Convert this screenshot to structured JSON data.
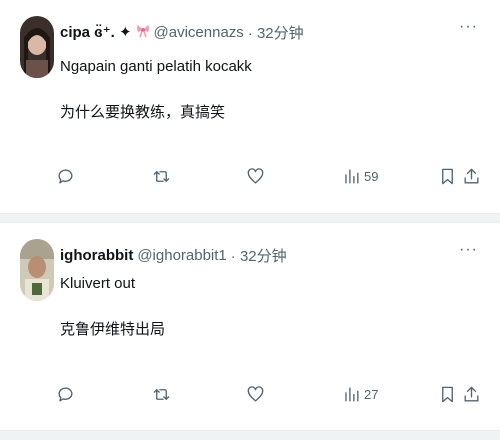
{
  "tweets": [
    {
      "name": "cipa ɞ̈⁺. ✦",
      "emoji_name": "pink-bow-emoji",
      "handle": "@avicennazs",
      "time": "· 32分钟",
      "text": "Ngapain ganti pelatih kocakk",
      "translation": "为什么要换教练，真搞笑",
      "views": "59",
      "more": "···"
    },
    {
      "name": "ighorabbit",
      "handle": "@ighorabbit1",
      "time": "· 32分钟",
      "text": "Kluivert out",
      "translation": "克鲁伊维特出局",
      "views": "27",
      "more": "···"
    }
  ],
  "icons": {
    "reply": "reply-icon",
    "retweet": "retweet-icon",
    "like": "like-icon",
    "views": "views-icon",
    "bookmark": "bookmark-icon",
    "share": "share-icon"
  },
  "colors": {
    "text": "#0f1419",
    "secondary": "#536471",
    "divider": "#eff3f4"
  }
}
